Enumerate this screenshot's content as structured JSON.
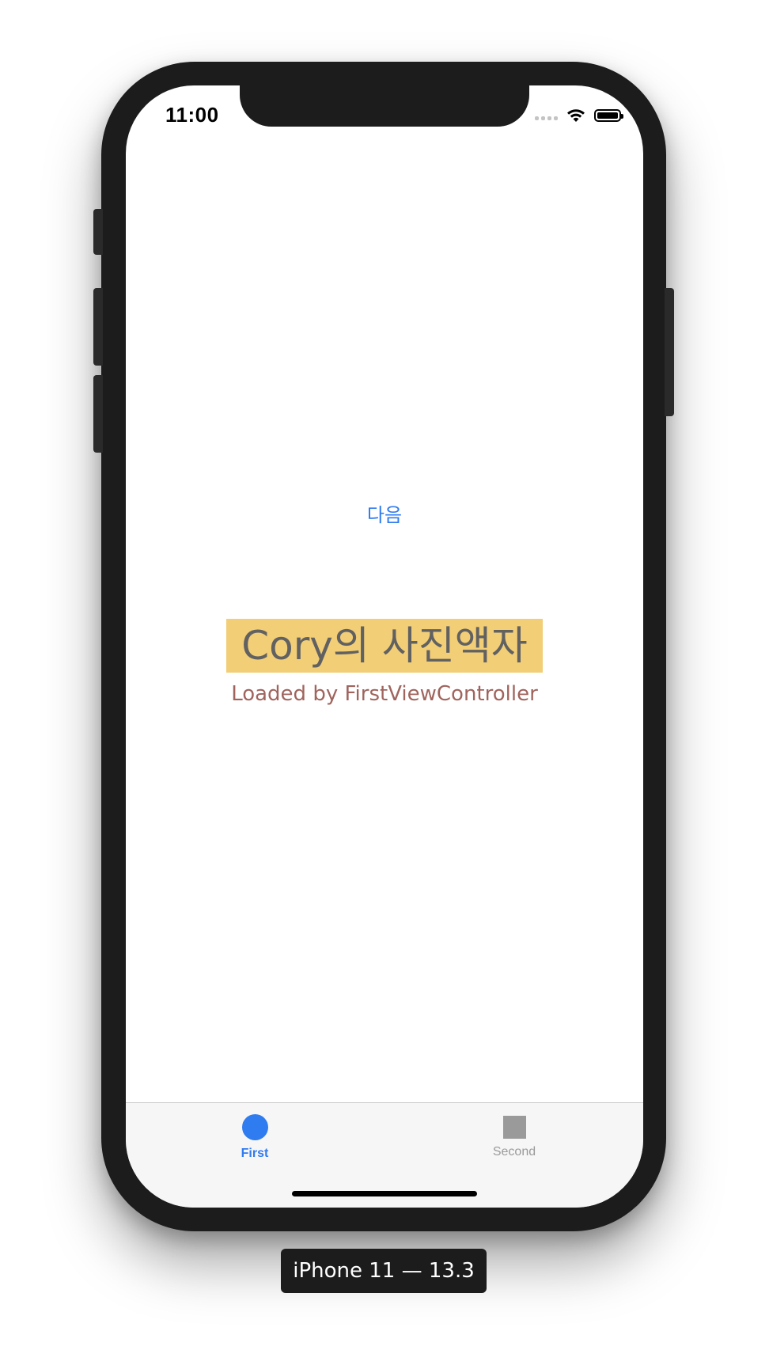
{
  "status_bar": {
    "time": "11:00"
  },
  "main": {
    "next_button_label": "다음",
    "title": "Cory의 사진액자",
    "subtitle": "Loaded by FirstViewController"
  },
  "tab_bar": {
    "tabs": [
      {
        "label": "First",
        "icon": "circle-icon",
        "selected": true
      },
      {
        "label": "Second",
        "icon": "square-icon",
        "selected": false
      }
    ]
  },
  "device_label": "iPhone 11 — 13.3",
  "colors": {
    "accent": "#2f7bf0",
    "title_background": "#f2ce77",
    "title_text": "#616161",
    "subtitle_text": "#a0645d",
    "inactive_tab": "#9a9a9a"
  }
}
